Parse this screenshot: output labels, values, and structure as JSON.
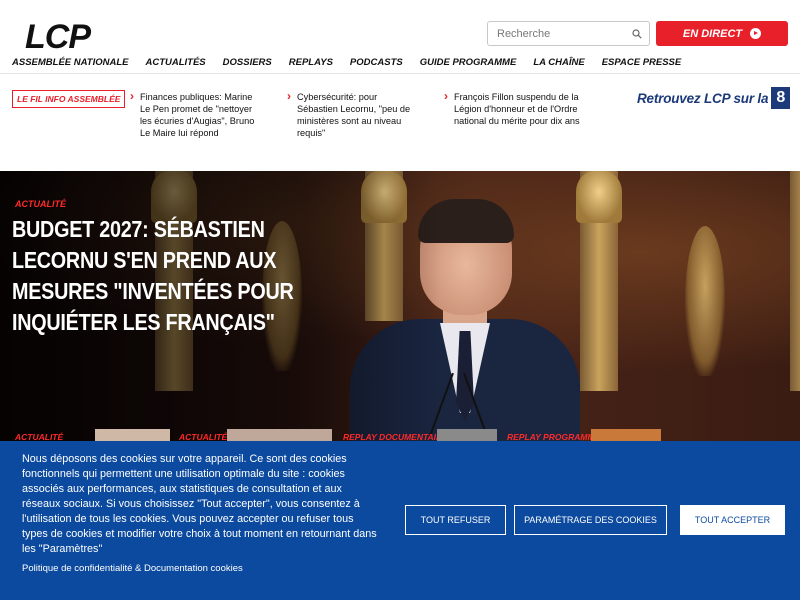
{
  "header": {
    "logo": "LCP",
    "nav": [
      "ASSEMBLÉE NATIONALE",
      "ACTUALITÉS",
      "DOSSIERS",
      "REPLAYS",
      "PODCASTS",
      "GUIDE PROGRAMME",
      "LA CHAÎNE",
      "ESPACE PRESSE"
    ],
    "search_placeholder": "Recherche",
    "live_label": "EN DIRECT"
  },
  "fil_info": {
    "label": "LE FIL INFO ASSEMBLÉE",
    "items": [
      "Finances publiques: Marine Le Pen promet de \"nettoyer les écuries d'Augias\", Bruno Le Maire lui répond",
      "Cybersécurité: pour Sébastien Lecornu, \"peu de ministères sont au niveau requis\"",
      "François Fillon suspendu de la Légion d'honneur et de l'Ordre national du mérite pour dix ans"
    ],
    "channel_text": "Retrouvez LCP sur la",
    "channel_number": "8"
  },
  "hero": {
    "category": "ACTUALITÉ",
    "title": "BUDGET 2027: SÉBASTIEN LECORNU S'EN PREND AUX MESURES \"INVENTÉES POUR INQUIÉTER LES FRANÇAIS\""
  },
  "cards": [
    {
      "label": "ACTUALITÉ"
    },
    {
      "label": "ACTUALITÉ"
    },
    {
      "label": "REPLAY DOCUMENTAIRE"
    },
    {
      "label": "REPLAY PROGRAMME"
    }
  ],
  "cookie": {
    "text": "Nous déposons des cookies sur votre appareil. Ce sont des cookies fonctionnels qui permettent une utilisation optimale du site : cookies associés aux performances, aux statistiques de consultation et aux réseaux sociaux. Si vous choisissez \"Tout accepter\", vous consentez à l'utilisation de tous les cookies. Vous pouvez accepter ou refuser tous types de cookies et modifier votre choix à tout moment en retournant dans les \"Paramètres\"",
    "policy_link": "Politique de confidentialité & Documentation cookies",
    "refuse_label": "TOUT REFUSER",
    "settings_label": "PARAMÉTRAGE DES COOKIES",
    "accept_label": "TOUT ACCEPTER"
  },
  "colors": {
    "brand_red": "#e8202a",
    "cookie_blue": "#0b4a9e",
    "channel_blue": "#1c3a7a"
  }
}
